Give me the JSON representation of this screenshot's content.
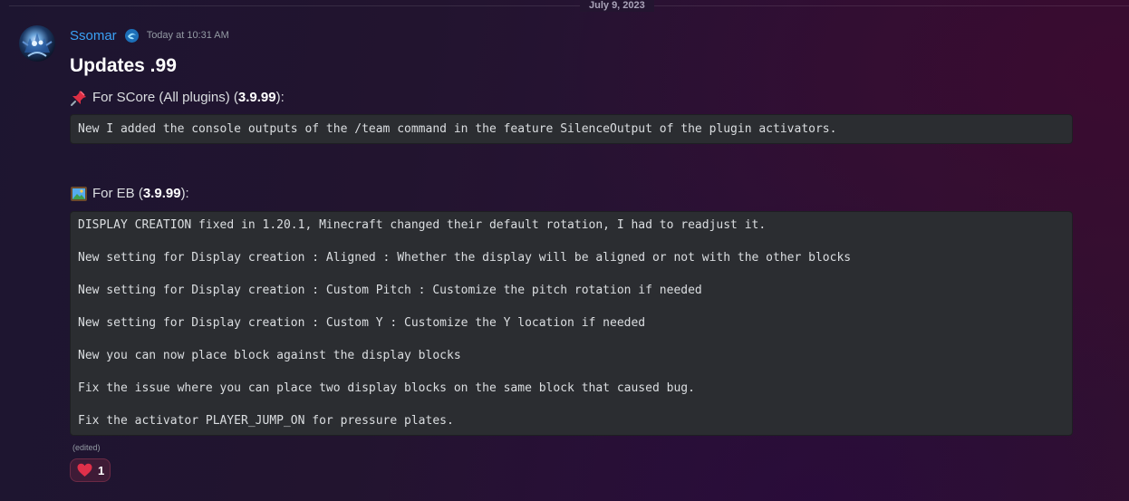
{
  "date_divider": "July 9, 2023",
  "message": {
    "author": "Ssomar",
    "timestamp": "Today at 10:31 AM",
    "author_icon": "sparkle-swirl-icon",
    "avatar_icon": "creature-avatar",
    "title": "Updates .99",
    "sections": [
      {
        "icon": "pushpin-icon",
        "prefix": "For SCore (All plugins) (",
        "version": "3.9.99",
        "suffix": "):",
        "code_lines": [
          "New I added the console outputs of the /team command in the feature SilenceOutput of the plugin activators."
        ]
      },
      {
        "icon": "framed-picture-icon",
        "prefix": "For EB (",
        "version": "3.9.99",
        "suffix": "):",
        "code_lines": [
          "DISPLAY CREATION fixed in 1.20.1, Minecraft changed their default rotation, I had to readjust it.",
          "New setting for Display creation : Aligned : Whether the display will be aligned or not with the other blocks",
          "New setting for Display creation : Custom Pitch : Customize the pitch rotation if needed",
          "New setting for Display creation : Custom Y : Customize the Y location if needed",
          "New you can now place block against the display blocks",
          "Fix the issue where you can place two display blocks on the same block that caused bug.",
          "Fix the activator PLAYER_JUMP_ON for pressure plates."
        ]
      }
    ],
    "edited_label": "(edited)",
    "reaction": {
      "emoji": "red-heart-icon",
      "count": "1"
    }
  },
  "colors": {
    "username": "#3aa1f5",
    "codeblock_bg": "#2b2d31",
    "heart": "#e0304a"
  }
}
